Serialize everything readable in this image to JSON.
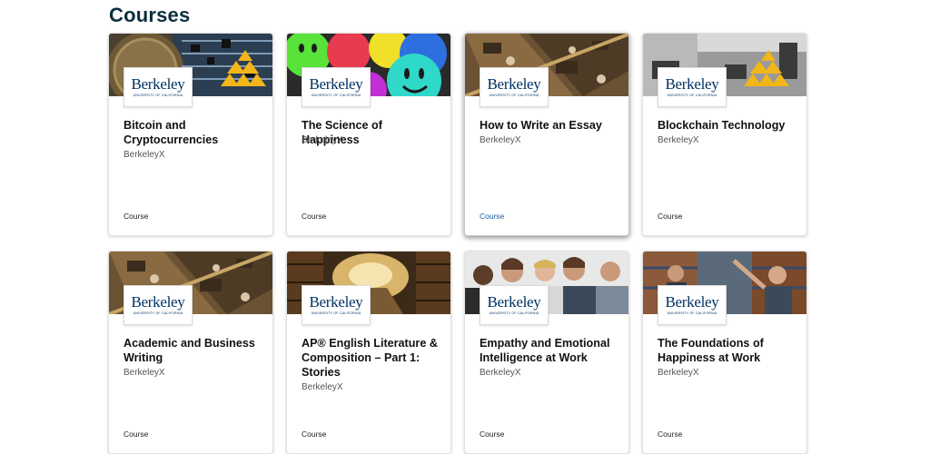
{
  "page": {
    "title": "Courses"
  },
  "logo": {
    "word": "Berkeley",
    "sub": "University of California"
  },
  "courses": [
    {
      "title": "Bitcoin and Cryptocurrencies",
      "org": "BerkeleyX",
      "type": "Course",
      "image": "bitcoin-circuit"
    },
    {
      "title": "The Science of Happiness",
      "org": "BerkeleyX",
      "type": "Course",
      "image": "smiley-faces"
    },
    {
      "title": "How to Write an Essay",
      "org": "BerkeleyX",
      "type": "Course",
      "image": "library-study"
    },
    {
      "title": "Blockchain Technology",
      "org": "BerkeleyX",
      "type": "Course",
      "image": "blockchain-office"
    },
    {
      "title": "Academic and Business Writing",
      "org": "BerkeleyX",
      "type": "Course",
      "image": "library-study"
    },
    {
      "title": "AP® English Literature & Composition – Part 1: Stories",
      "org": "BerkeleyX",
      "type": "Course",
      "image": "library-books"
    },
    {
      "title": "Empathy and Emotional Intelligence at Work",
      "org": "BerkeleyX",
      "type": "Course",
      "image": "happy-crowd"
    },
    {
      "title": "The Foundations of Happiness at Work",
      "org": "BerkeleyX",
      "type": "Course",
      "image": "warehouse-team"
    }
  ]
}
